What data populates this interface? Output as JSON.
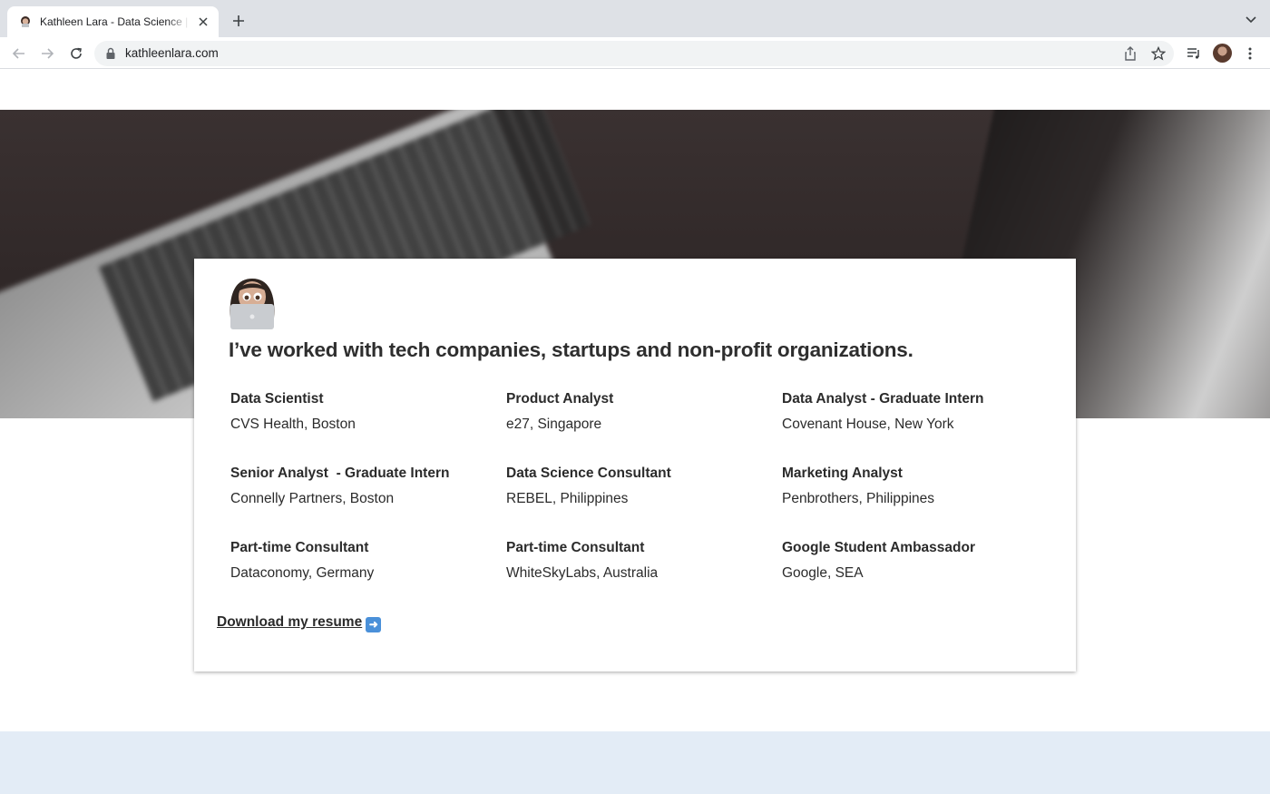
{
  "browser": {
    "tab_title": "Kathleen Lara - Data Science |",
    "url": "kathleenlara.com"
  },
  "page": {
    "headline": "I’ve worked with tech companies, startups and non-profit organizations.",
    "jobs": [
      {
        "title": "Data Scientist",
        "org": "CVS Health, Boston"
      },
      {
        "title": "Product Analyst",
        "org": "e27,  Singapore"
      },
      {
        "title": "Data Analyst - Graduate Intern",
        "org": "Covenant House, New York"
      },
      {
        "title": "Senior Analyst  - Graduate Intern",
        "org": "Connelly Partners, Boston"
      },
      {
        "title": "Data Science Consultant",
        "org": "REBEL, Philippines"
      },
      {
        "title": "Marketing Analyst",
        "org": "Penbrothers, Philippines"
      },
      {
        "title": "Part-time Consultant",
        "org": "Dataconomy, Germany"
      },
      {
        "title": "Part-time Consultant",
        "org": "WhiteSkyLabs, Australia"
      },
      {
        "title": "Google Student Ambassador",
        "org": "Google, SEA"
      }
    ],
    "resume_link": "Download my resume",
    "resume_icon": "right-arrow-icon"
  },
  "colors": {
    "text": "#2b2b2b",
    "tabbar": "#dee1e6",
    "bottom_band": "#e3ecf6"
  }
}
